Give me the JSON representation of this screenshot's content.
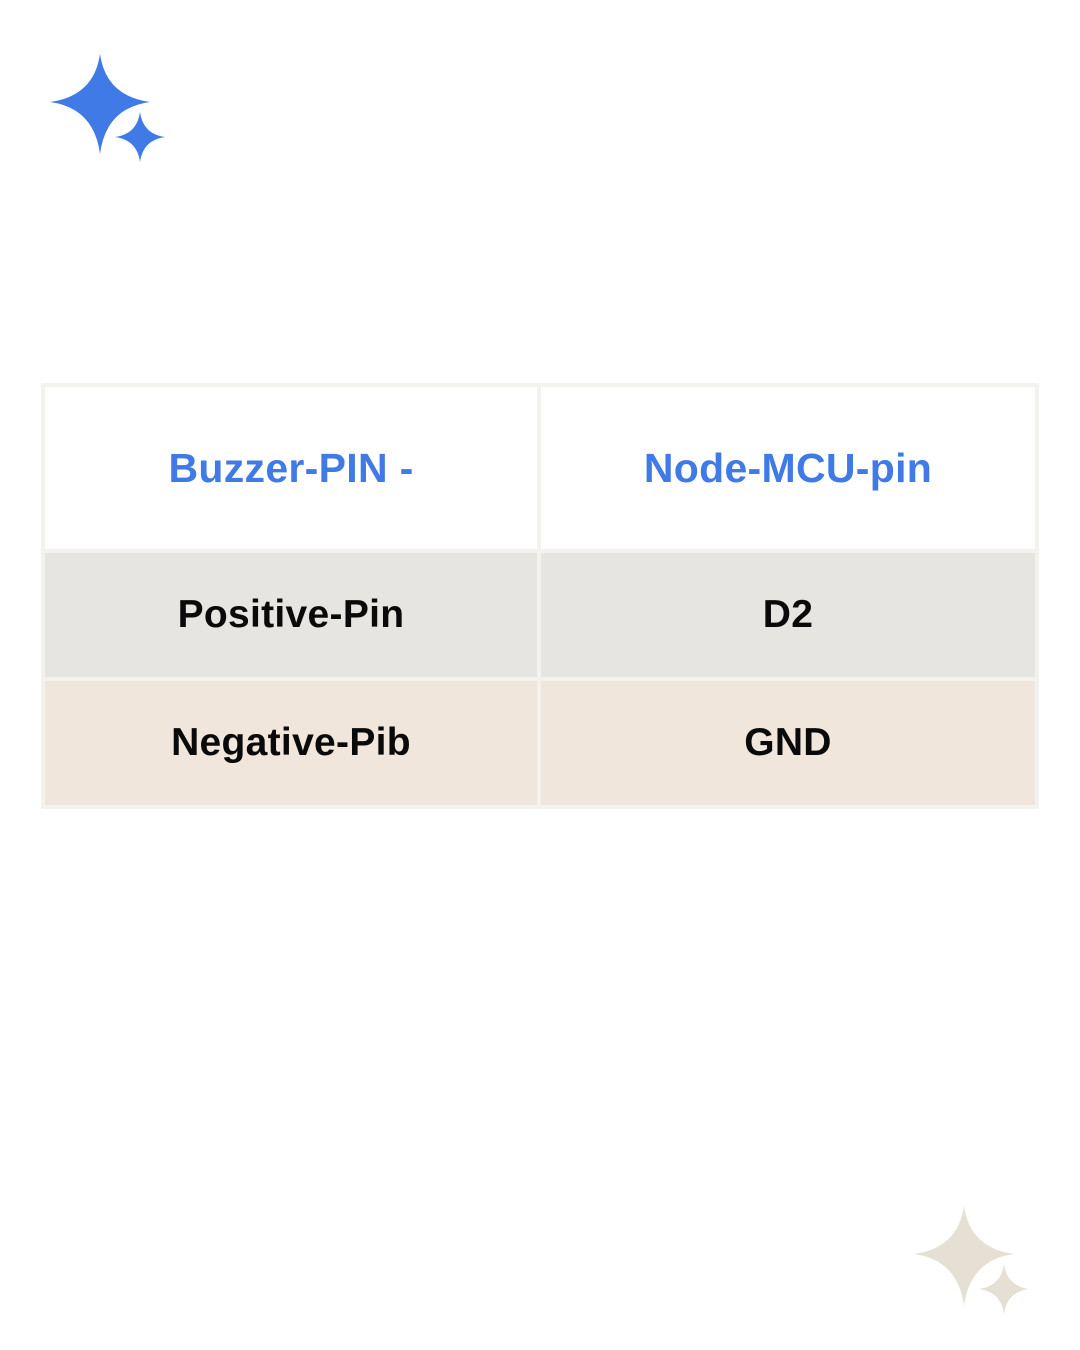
{
  "decor": {
    "top_sparkle_icon": "sparkle-icon",
    "top_sparkle_color": "#3f7ae6",
    "bottom_sparkle_icon": "sparkle-icon",
    "bottom_sparkle_color": "#e6e0d4"
  },
  "table": {
    "headers": [
      "Buzzer-PIN -",
      "Node-MCU-pin"
    ],
    "rows": [
      [
        "Positive-Pin",
        "D2"
      ],
      [
        "Negative-Pib",
        "GND"
      ]
    ],
    "colors": {
      "header_text": "#3f7ae6",
      "header_bg": "#ffffff",
      "row1_bg": "#e7e5e1",
      "row2_bg": "#f1e6db",
      "border": "#f3f2ee"
    }
  }
}
